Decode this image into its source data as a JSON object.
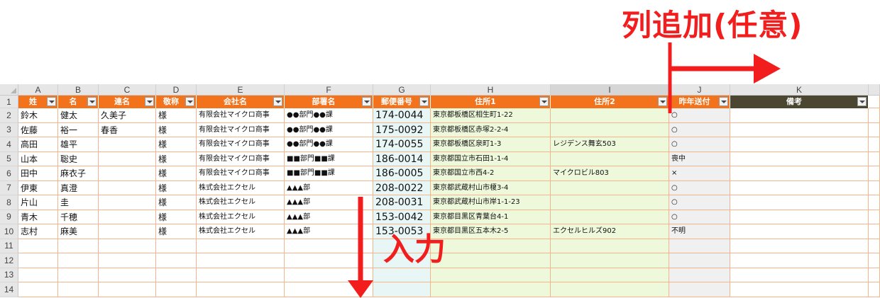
{
  "annotations": {
    "add_column": "列追加(任意)",
    "input": "入力"
  },
  "column_letters": [
    "A",
    "B",
    "C",
    "D",
    "E",
    "F",
    "G",
    "H",
    "I",
    "J",
    "K"
  ],
  "row_numbers": [
    "1",
    "2",
    "3",
    "4",
    "5",
    "6",
    "7",
    "8",
    "9",
    "10",
    "11",
    "12",
    "13",
    "14"
  ],
  "headers": [
    "姓",
    "名",
    "連名",
    "敬称",
    "会社名",
    "部署名",
    "郵便番号",
    "住所1",
    "住所2",
    "昨年送付",
    "備考"
  ],
  "rows": [
    [
      "鈴木",
      "健太",
      "久美子",
      "様",
      "有限会社マイクロ商事",
      "●●部門●●課",
      "174-0044",
      "東京都板橋区相生町1-22",
      "",
      "○",
      ""
    ],
    [
      "佐藤",
      "裕一",
      "春香",
      "様",
      "有限会社マイクロ商事",
      "●●部門●●課",
      "175-0092",
      "東京都板橋区赤塚2-2-4",
      "",
      "○",
      ""
    ],
    [
      "高田",
      "雄平",
      "",
      "様",
      "有限会社マイクロ商事",
      "●●部門●●課",
      "174-0055",
      "東京都板橋区泉町1-3",
      "レジデンス舞玄503",
      "○",
      ""
    ],
    [
      "山本",
      "聡史",
      "",
      "様",
      "有限会社マイクロ商事",
      "■■部門■■課",
      "186-0014",
      "東京都国立市石田1-1-4",
      "",
      "喪中",
      ""
    ],
    [
      "田中",
      "麻衣子",
      "",
      "様",
      "有限会社マイクロ商事",
      "■■部門■■課",
      "186-0005",
      "東京都国立市西4-2",
      "マイクロビル803",
      "×",
      ""
    ],
    [
      "伊東",
      "真澄",
      "",
      "様",
      "株式会社エクセル",
      "▲▲▲部",
      "208-0022",
      "東京都武蔵村山市榎3-4",
      "",
      "○",
      ""
    ],
    [
      "片山",
      "圭",
      "",
      "様",
      "株式会社エクセル",
      "▲▲▲部",
      "208-0031",
      "東京都武蔵村山市岸1-1-23",
      "",
      "○",
      ""
    ],
    [
      "青木",
      "千穂",
      "",
      "様",
      "株式会社エクセル",
      "▲▲▲部",
      "153-0042",
      "東京都目黒区青葉台4-1",
      "",
      "○",
      ""
    ],
    [
      "志村",
      "麻美",
      "",
      "様",
      "株式会社エクセル",
      "▲▲▲部",
      "153-0053",
      "東京都目黒区五本木2-5",
      "エクセルヒルズ902",
      "不明",
      ""
    ]
  ],
  "colors": {
    "header_orange": "#f3721c",
    "header_dark": "#4a4632",
    "arrow_red": "#f21e1e",
    "zip_fill": "#e9f6f6",
    "addr_fill": "#eef9dc"
  }
}
